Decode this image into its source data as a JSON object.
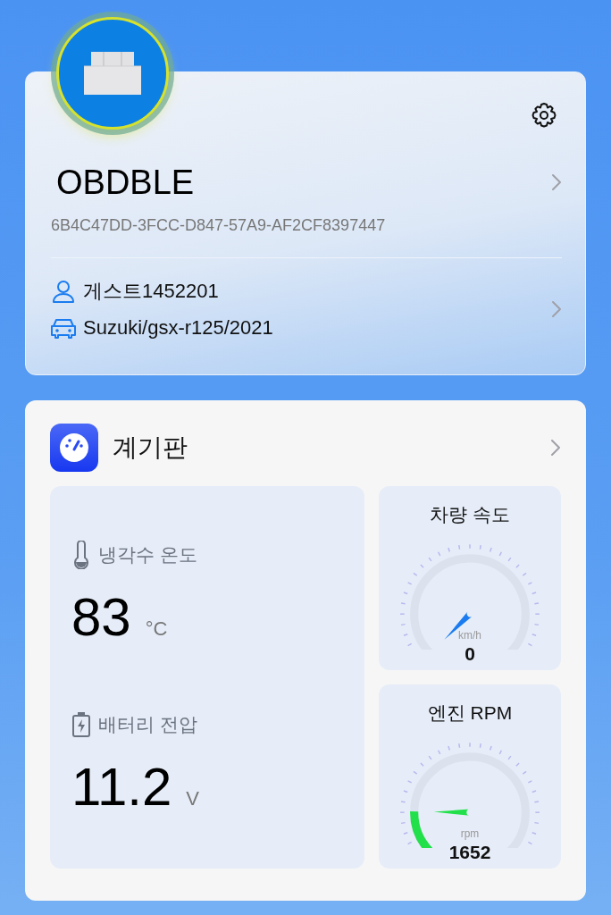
{
  "device": {
    "name": "OBDBLE",
    "uuid": "6B4C47DD-3FCC-D847-57A9-AF2CF8397447",
    "user": "게스트1452201",
    "vehicle": "Suzuki/gsx-r125/2021"
  },
  "dashboard": {
    "title": "계기판",
    "readings": [
      {
        "kind": "temperature",
        "label": "냉각수 온도",
        "value": "83",
        "unit": "°C"
      },
      {
        "kind": "battery",
        "label": "배터리 전압",
        "value": "11.2",
        "unit": "V"
      }
    ],
    "gauges": [
      {
        "title": "차량 속도",
        "unit": "km/h",
        "value": "0",
        "color": "#1a7cf0"
      },
      {
        "title": "엔진 RPM",
        "unit": "rpm",
        "value": "1652",
        "color": "#22e04a"
      }
    ]
  }
}
